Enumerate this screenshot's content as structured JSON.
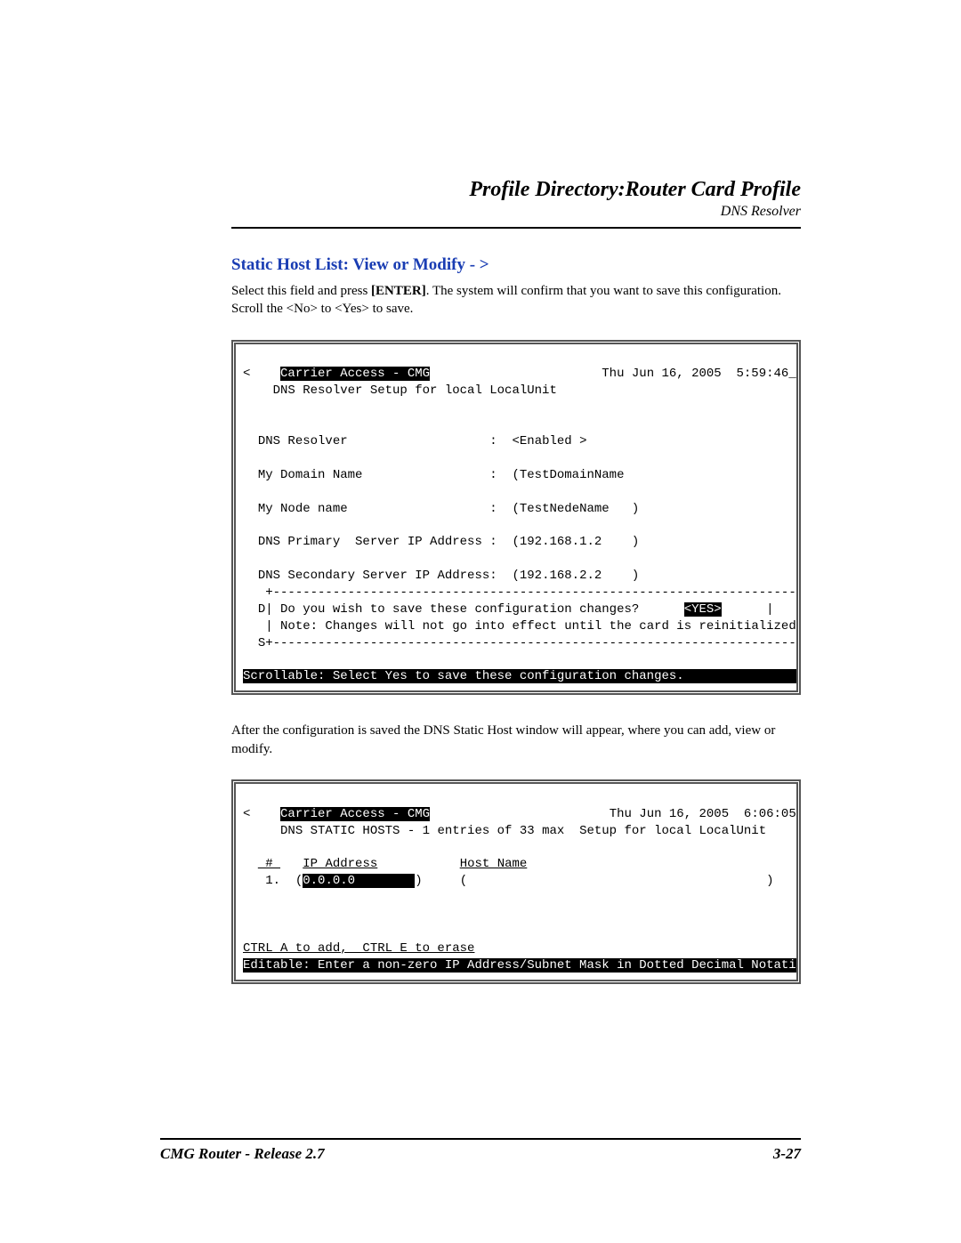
{
  "header": {
    "title": "Profile Directory:Router Card Profile",
    "subtitle": "DNS Resolver"
  },
  "section": {
    "title": "Static Host List: View or Modify - >",
    "intro_prefix": "Select this field and press ",
    "intro_key": "[ENTER]",
    "intro_suffix": ". The system will confirm that you want to save this configuration. Scroll the <No> to <Yes> to save."
  },
  "terminal1": {
    "prompt_left": "<",
    "title": "Carrier Access - CMG",
    "timestamp": "Thu Jun 16, 2005  5:59:46_",
    "prompt_right": ">",
    "subtitle": "DNS Resolver Setup for local LocalUnit",
    "fields": {
      "dns_resolver_label": "DNS Resolver",
      "dns_resolver_value": "<Enabled >",
      "domain_label": "My Domain Name",
      "domain_value": "(TestDomainName",
      "domain_close": ")",
      "node_label": "My Node name",
      "node_value": "(TestNedeName   )",
      "primary_label": "DNS Primary  Server IP Address :",
      "primary_value": "(192.168.1.2    )",
      "secondary_label": "DNS Secondary Server IP Address:",
      "secondary_value": "(192.168.2.2    )"
    },
    "dialog": {
      "border_top": "+----------------------------------------------------------------------+",
      "line1_prefix": "D|",
      "line1_text": " Do you wish to save these configuration changes?      ",
      "yes_button": "<YES>",
      "line1_suffix": "      |",
      "line2_prefix": " |",
      "line2_text": " Note: Changes will not go into effect until the card is reinitialized. |",
      "border_bot_prefix": "S+",
      "border_bot": "----------------------------------------------------------------------+"
    },
    "status": "Scrollable: Select Yes to save these configuration changes.                   "
  },
  "mid_text": "After the configuration is saved the DNS Static Host window will appear, where you can add, view or modify.",
  "terminal2": {
    "prompt_left": "<",
    "title": "Carrier Access - CMG",
    "timestamp": "Thu Jun 16, 2005  6:06:05",
    "prompt_right": ">",
    "subtitle": "DNS STATIC HOSTS - 1 entries of 33 max  Setup for local LocalUnit",
    "col_num": " # ",
    "col_ip": "IP Address",
    "col_host": "Host Name",
    "row_num": "1.",
    "row_ip_open": "(",
    "row_ip": "0.0.0.0        ",
    "row_ip_close": ")",
    "row_host_open": "(",
    "row_host_close": ")",
    "hint": "CTRL A to add,  CTRL E to erase",
    "status": "Editable: Enter a non-zero IP Address/Subnet Mask in Dotted Decimal Notation. "
  },
  "footer": {
    "left": "CMG Router - Release 2.7",
    "right": "3-27"
  }
}
